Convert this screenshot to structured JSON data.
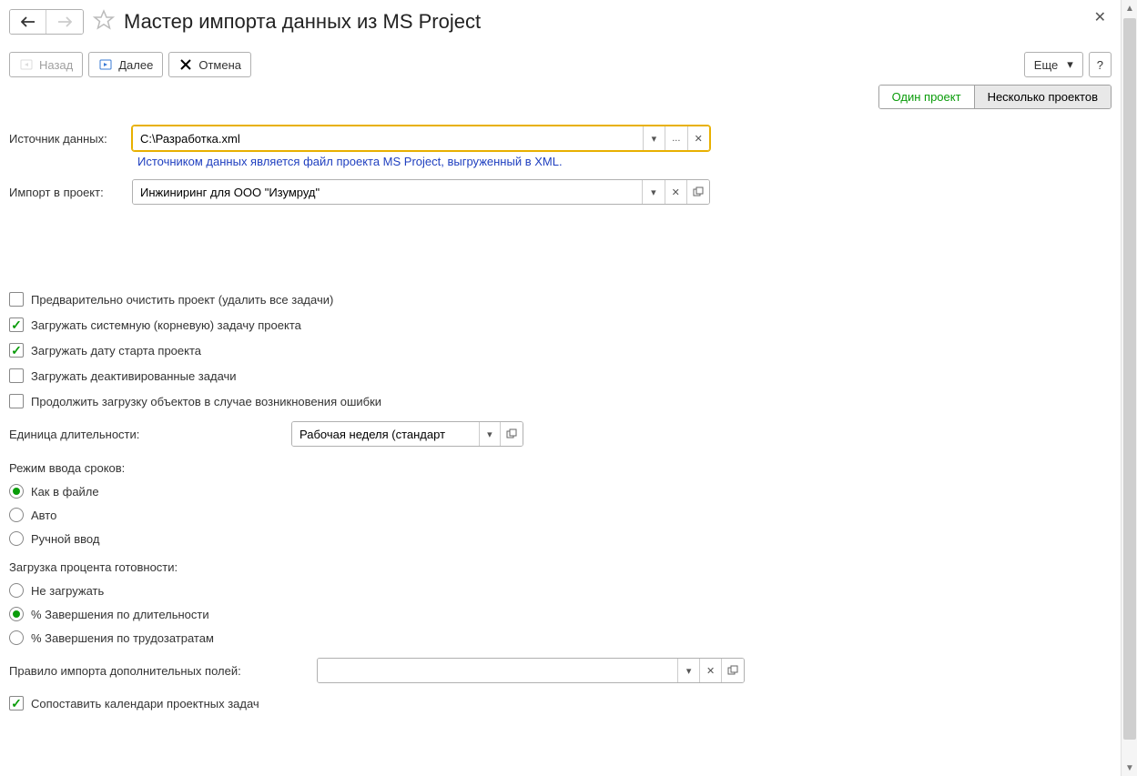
{
  "title": "Мастер импорта данных из MS Project",
  "nav": {
    "back_label": "Назад",
    "next_label": "Далее",
    "cancel_label": "Отмена"
  },
  "toolbar": {
    "more_label": "Еще",
    "help_label": "?"
  },
  "tabs": {
    "one": "Один проект",
    "many": "Несколько проектов"
  },
  "source": {
    "label": "Источник данных:",
    "value": "C:\\Разработка.xml",
    "hint": "Источником данных является файл проекта MS Project, выгруженный в XML."
  },
  "project": {
    "label": "Импорт в проект:",
    "value": "Инжиниринг для ООО \"Изумруд\""
  },
  "options": {
    "clear": "Предварительно очистить проект (удалить все задачи)",
    "load_root": "Загружать системную (корневую) задачу проекта",
    "load_start": "Загружать дату старта проекта",
    "load_inactive": "Загружать деактивированные задачи",
    "continue_on_error": "Продолжить загрузку объектов в случае возникновения ошибки",
    "map_calendars": "Сопоставить календари проектных задач"
  },
  "duration_unit": {
    "label": "Единица длительности:",
    "value": "Рабочая неделя (стандарт"
  },
  "dates_mode": {
    "label": "Режим ввода сроков:",
    "opt_file": "Как в файле",
    "opt_auto": "Авто",
    "opt_manual": "Ручной ввод"
  },
  "progress": {
    "label": "Загрузка процента готовности:",
    "opt_none": "Не загружать",
    "opt_duration": "% Завершения по длительности",
    "opt_work": "% Завершения по трудозатратам"
  },
  "custom_fields": {
    "label": "Правило импорта дополнительных полей:",
    "value": ""
  },
  "icons": {
    "ellipsis": "..."
  }
}
